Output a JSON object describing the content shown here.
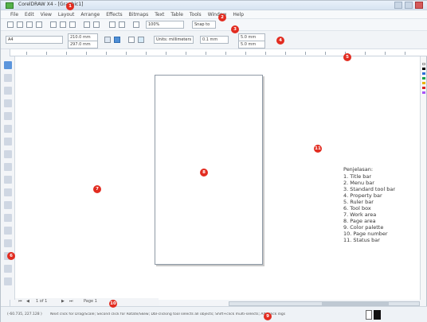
{
  "window": {
    "title": "CorelDRAW X4 - [Graphic1]"
  },
  "menubar": {
    "items": [
      "File",
      "Edit",
      "View",
      "Layout",
      "Arrange",
      "Effects",
      "Bitmaps",
      "Text",
      "Table",
      "Tools",
      "Window",
      "Help"
    ]
  },
  "standard_toolbar": {
    "zoom_value": "100%",
    "snap_label": "Snap to"
  },
  "property_bar": {
    "paper_preset": "A4",
    "width_value": "210.0 mm",
    "height_value": "297.0 mm",
    "units_label": "Units: millimeters",
    "nudge_value": "0.1 mm",
    "dup_x": "5.0 mm",
    "dup_y": "5.0 mm"
  },
  "page_nav": {
    "pages": "1 of 1",
    "page_tab": "Page 1"
  },
  "status_bar": {
    "coords": "(-60.735, 227.128 )",
    "message": "Next click for Drag/Scale; Second click for Rotate/Skew; Dbl-clicking tool selects all objects; Shift+click multi-selects; Alt+click digs"
  },
  "legend": {
    "title": "Penjelasan:",
    "items": [
      "1. Title bar",
      "2. Menu bar",
      "3. Standard tool bar",
      "4. Property bar",
      "5. Ruler bar",
      "6. Tool box",
      "7. Work area",
      "8. Page area",
      "9. Color palette",
      "10. Page number",
      "11. Status bar"
    ]
  },
  "callouts": [
    "1",
    "2",
    "3",
    "4",
    "5",
    "6",
    "7",
    "8",
    "9",
    "10",
    "11"
  ],
  "colors": {
    "callout": "#e22c20",
    "accent": "#2f82d8",
    "page_border": "#8f9aa6"
  }
}
